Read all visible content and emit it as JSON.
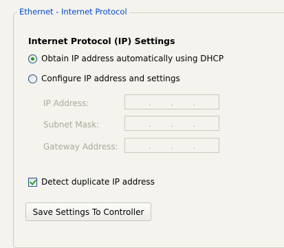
{
  "group": {
    "title": "Ethernet - Internet Protocol"
  },
  "section": {
    "heading": "Internet Protocol (IP) Settings"
  },
  "radios": [
    {
      "label": "Obtain IP address automatically using DHCP",
      "checked": true
    },
    {
      "label": "Configure IP address and settings",
      "checked": false
    }
  ],
  "fields": [
    {
      "label": "IP Address:",
      "value": " .   .   ."
    },
    {
      "label": "Subnet Mask:",
      "value": " .   .   ."
    },
    {
      "label": "Gateway Address:",
      "value": " .   .   ."
    }
  ],
  "checkbox": {
    "label": "Detect duplicate IP address",
    "checked": true
  },
  "button": {
    "label": "Save Settings To Controller"
  },
  "colors": {
    "legend": "#0046d5",
    "disabled_text": "#aca899",
    "check_green": "#21a121"
  }
}
